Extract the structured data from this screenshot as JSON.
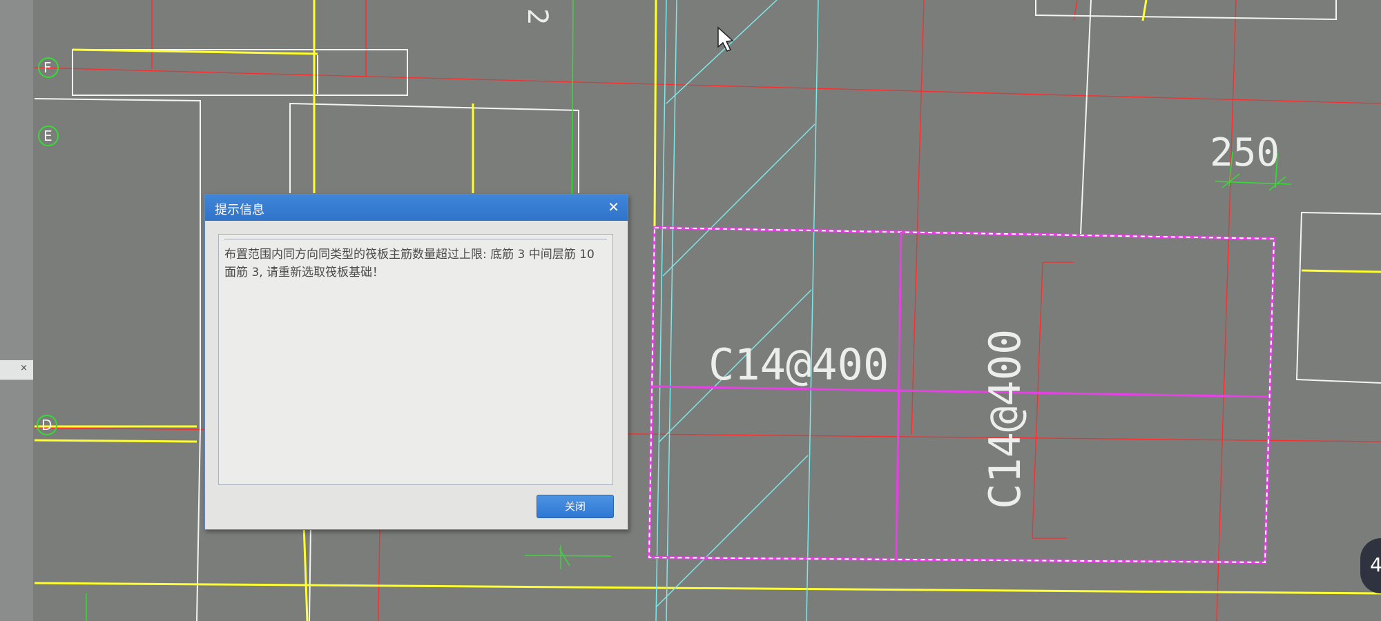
{
  "grid_axes": {
    "f": "F",
    "e": "E",
    "d": "D",
    "top_number": "2"
  },
  "annotations": {
    "rebar_horizontal": "C14@400",
    "rebar_vertical": "C14@400",
    "dimension": "250"
  },
  "dialog": {
    "title": "提示信息",
    "message": "布置范围内同方向同类型的筏板主筋数量超过上限: 底筋 3 中间层筋 10 面筋 3, 请重新选取筏板基础！",
    "close_button_label": "关闭"
  },
  "left_panel": {
    "close_glyph": "×"
  },
  "corner_badge": "4",
  "colors": {
    "background": "#7b7d7a",
    "magenta": "#e640e6",
    "yellow": "#ffff33",
    "red": "#ff2a2a",
    "cyan": "#7fe8e8",
    "green": "#33dd33",
    "dialog_title": "#2f74c9"
  }
}
